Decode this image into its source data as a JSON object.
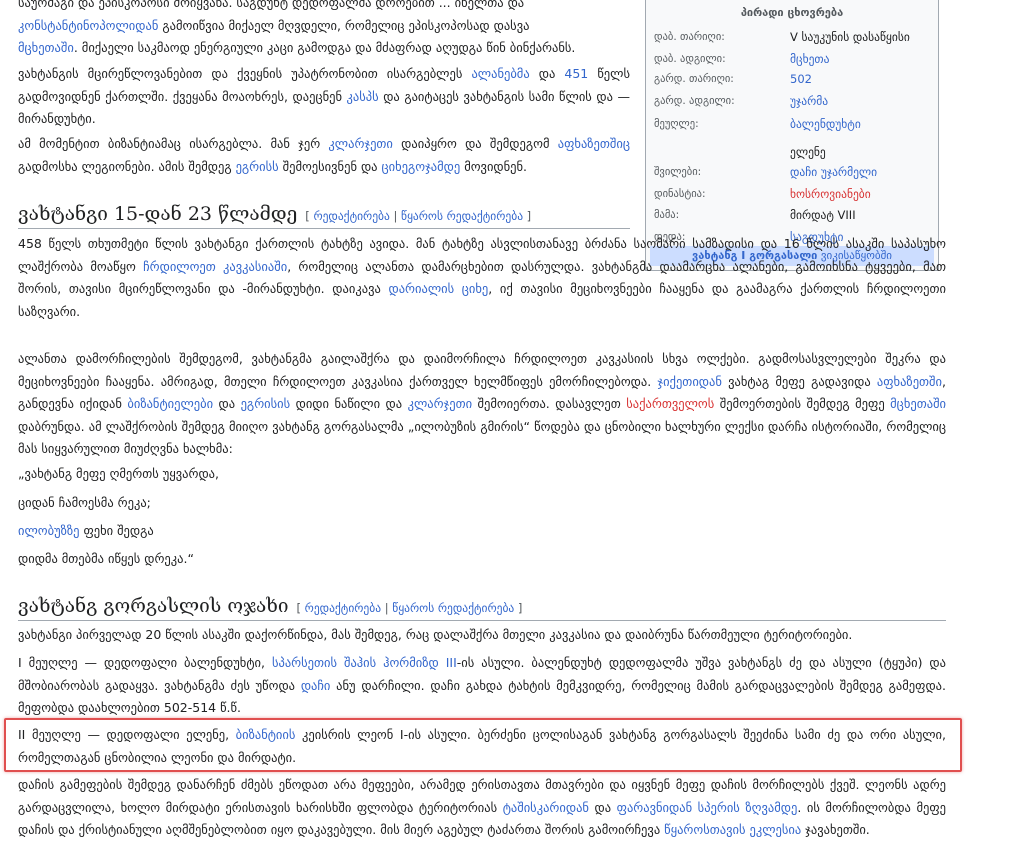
{
  "infobox": {
    "header": "პირადი ცხოვრება",
    "rows": [
      {
        "key": "დაბ. თარიღი:",
        "value": "V საუკუნის დასაწყისი",
        "link": false
      },
      {
        "key": "დაბ. ადგილი:",
        "value": "მცხეთა",
        "link": true
      },
      {
        "key": "გარდ. თარიღი:",
        "value": "502",
        "link": true
      },
      {
        "key": "გარდ. ადგილი:",
        "value": "უჯარმა",
        "link": true
      },
      {
        "key": "მეუღლე:",
        "value": "ბალენდუხტი",
        "link": true
      },
      {
        "key": "",
        "value": "ელენე",
        "link": false
      },
      {
        "key": "შვილები:",
        "value": "დაჩი უჯარმელი",
        "link": true
      },
      {
        "key": "დინასტია:",
        "value": "ხოსროვიანები",
        "link": "red"
      },
      {
        "key": "მამა:",
        "value": "მირდატ VIII",
        "link": false
      },
      {
        "key": "დედა:",
        "value": "საგდუხტი",
        "link": true
      }
    ],
    "footer_bold": "ვახტანგ I გორგასალი",
    "footer_rest": " ვიკისაწყობში"
  },
  "p0": {
    "l1a": "საურმაგი და ეპისკოპოსი მოიყვანა. საგდუხტ დედოფალმა დროებით ... ინელთა და",
    "l2a": "კონსტანტინოპოლიდან",
    "l2b": " გამოიწვია მიქაელ მღვდელი, რომელიც ეპისკოპოსად დასვა",
    "l3a": "მცხეთაში",
    "l3b": ". მიქაელი საკმაოდ ენერგიული კაცი გამოდგა და მძაფრად აღუდგა წინ ბინქარანს."
  },
  "p1": {
    "a": "ვახტანგის მცირეწლოვანებით და ქვეყნის უპატრონობით ისარგებლეს ",
    "b": "ალანებმა",
    "c": " და ",
    "d": "451",
    "e": " წელს გადმოვიდნენ ქართლში. ქვეყანა მოაოხრეს, დაეცნენ ",
    "f": "კასპს",
    "g": " და გაიტაცეს ვახტანგის სამი წლის და — მირანდუხტი."
  },
  "p2": {
    "a": "ამ მომენტით ბიზანტიამაც ისარგებლა. მან ჯერ ",
    "b": "კლარჯეთი",
    "c": " დაიპყრო და შემდეგომ ",
    "d": "აფხაზეთშიც",
    "e": " გადმოსხა ლეგიონები. ამის შემდეგ ",
    "f": "ეგრისს",
    "g": " შემოესივნენ და ",
    "h": "ციხეგოჯამდე",
    "i": " მოვიდნენ."
  },
  "h_a": {
    "title": "ვახტანგი 15-დან 23 წლამდე",
    "edit": "რედაქტირება",
    "edit_src": "წყაროს რედაქტირება"
  },
  "p3": {
    "a": "458 წელს თხუთმეტი წლის ვახტანგი ქართლის ტახტზე ავიდა. მან ტახტზე ასვლისთანავე ბრძანა საომარი სამზადისი და 16 წლის ასაკში საპასუხო ლაშქრობა მოაწყო ",
    "b": "ჩრდილოეთ კავკასიაში",
    "c": ", რომელიც ალანთა დამარცხებით დასრულდა. ვახტანგმა დაამარცხა ალანები, გამოიხსნა ტყვეები, მათ შორის, თავისი მცირეწლოვანი და -მირანდუხტი. დაიკავა ",
    "d": "დარიალის ციხე",
    "e": ", იქ თავისი მეციხოვნეები ჩააყენა და გაამაგრა ქართლის ჩრდილოეთი საზღვარი."
  },
  "p4": {
    "a": "ალანთა დამორჩილების შემდეგომ, ვახტანგმა გაილაშქრა და დაიმორჩილა ჩრდილოეთ კავკასიის სხვა ოლქები. გადმოსასვლელები შეკრა და მეციხოვნეები ჩააყენა. ამრიგად, მთელი ჩრდილოეთ კავკასია ქართველ ხელმწიფეს ემორჩილებოდა. ",
    "b": "ჯიქეთიდან",
    "c": " ვახტაგ მეფე გადავიდა ",
    "d": "აფხაზეთში",
    "e": ", განდევნა იქიდან ",
    "f": "ბიზანტიელები",
    "g": " და ",
    "h": "ეგრისის",
    "i": " დიდი ნაწილი და ",
    "j": "კლარჯეთი",
    "k": " შემოიერთა. დასავლეთ ",
    "l": "საქართველოს",
    "m": " შემოერთების შემდეგ მეფე ",
    "n": "მცხეთაში",
    "o": " დაბრუნდა. ამ ლაშქრობის შემდეგ მიიღო ვახტანგ გორგასალმა „ილობუზის გმირის“ წოდება და ცნობილი ხალხური ლექსი დარჩა ისტორიაში, რომელიც მას სიყვარულით მიუძღვნა ხალხმა:"
  },
  "poem": {
    "l1": "„ვახტანგ მეფე ღმერთს უყვარდა,",
    "l2": "ციდან ჩამოესმა რეკა;",
    "l3a": "ილობუზზე",
    "l3b": " ფეხი შედგა",
    "l4": "დიდმა მთებმა იწყეს დრეკა.“"
  },
  "h_b": {
    "title": "ვახტანგ გორგასლის ოჯახი",
    "edit": "რედაქტირება",
    "edit_src": "წყაროს რედაქტირება"
  },
  "p5": "ვახტანგი პირველად 20 წლის ასაკში დაქორწინდა, მას შემდეგ, რაც დალაშქრა მთელი კავკასია და დაიბრუნა წართმეული ტერიტორიები.",
  "p6": {
    "a": "I მეუღლე — დედოფალი ბალენდუხტი, ",
    "b": "სპარსეთის შაჰის ჰორმიზდ III",
    "c": "-ის ასული. ბალენდუხტ დედოფალმა უშვა ვახტანგს ძე და ასული (ტყუპი) და მშობიარობას გადაყვა. ვახტანგმა ძეს უწოდა ",
    "d": "დაჩი",
    "e": " ანუ დარჩილი. დაჩი გახდა ტახტის მემკვიდრე, რომელიც მამის გარდაცვალების შემდეგ გამეფდა. მეფობდა დაახლოებით 502-514 წ.წ."
  },
  "p7": {
    "a": "II მეუღლე — დედოფალი ელენე, ",
    "b": "ბიზანტიის",
    "c": " კეისრის ლეონ I-ის ასული. ბერძენი ცოლისაგან ვახტანგ გორგასალს შეეძინა სამი ძე და ორი ასული, რომელთაგან ცნობილია ლეონი და მირდატი."
  },
  "p8": {
    "a": "დაჩის გამეფების შემდეგ დანარჩენ ძმებს ეწოდათ არა მეფეები, არამედ ერისთავთა მთავრები და იყვნენ მეფე დაჩის მორჩილებს ქვეშ. ლეონს ადრე გარდაცვლილა, ხოლო მირდატი ერისთავის ხარისხში ფლობდა ტერიტორიას ",
    "b": "ტაშისკარიდან",
    "c": " და ",
    "d": "ფარავნიდან სპერის ზღვამდე",
    "e": ". ის მორჩილობდა მეფე დაჩის და ქრისტიანული აღმშენებლობით იყო დაკავებული. მის მიერ აგებულ ტაძართა შორის გამოირჩევა ",
    "f": "წყაროსთავის ეკლესია",
    "g": " ჯავახეთში."
  }
}
